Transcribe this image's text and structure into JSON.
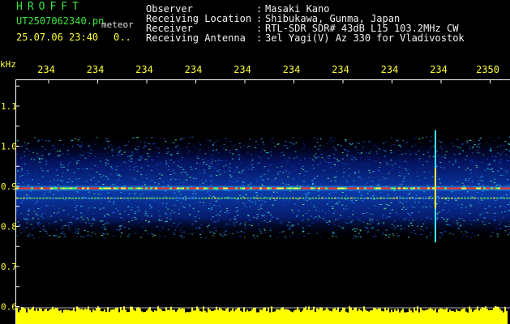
{
  "header": {
    "app_title": "HROFFT",
    "file_name": "UT2507062340.pn",
    "sub_label": "meteor",
    "datetime": "25.07.06 23:40",
    "flag": "0.."
  },
  "info": [
    {
      "label": "Observer",
      "value": "Masaki Kano"
    },
    {
      "label": "Receiving Location",
      "value": "Shibukawa, Gunma, Japan"
    },
    {
      "label": "Receiver",
      "value": "RTL-SDR SDR# 43dB L15 103.2MHz CW"
    },
    {
      "label": "Receiving Antenna",
      "value": "3el Yagi(V) Az 330 for Vladivostok"
    }
  ],
  "colors": {
    "background": "#000000",
    "header_text": "#f2f2f2",
    "title": "#3ce63c",
    "axis_text": "#ffff33",
    "grid": "#ffffff",
    "amplitude": "#ffff00"
  },
  "chart_data": {
    "type": "heatmap",
    "ylabel": "kHz",
    "y_ticks": [
      "1.1",
      "1.0",
      "0.9",
      "0.8",
      "0.7",
      "0.6"
    ],
    "x_ticks": [
      "234",
      "234",
      "234",
      "234",
      "234",
      "234",
      "234",
      "234",
      "234",
      "2350"
    ],
    "signals": [
      {
        "frequency_khz": 0.895,
        "note": "carrier line"
      },
      {
        "frequency_khz": 0.87,
        "note": "secondary line"
      }
    ],
    "noise_band_khz": [
      0.78,
      1.0
    ],
    "meteor_echo": {
      "frequency_range_khz": [
        0.76,
        1.04
      ]
    }
  }
}
